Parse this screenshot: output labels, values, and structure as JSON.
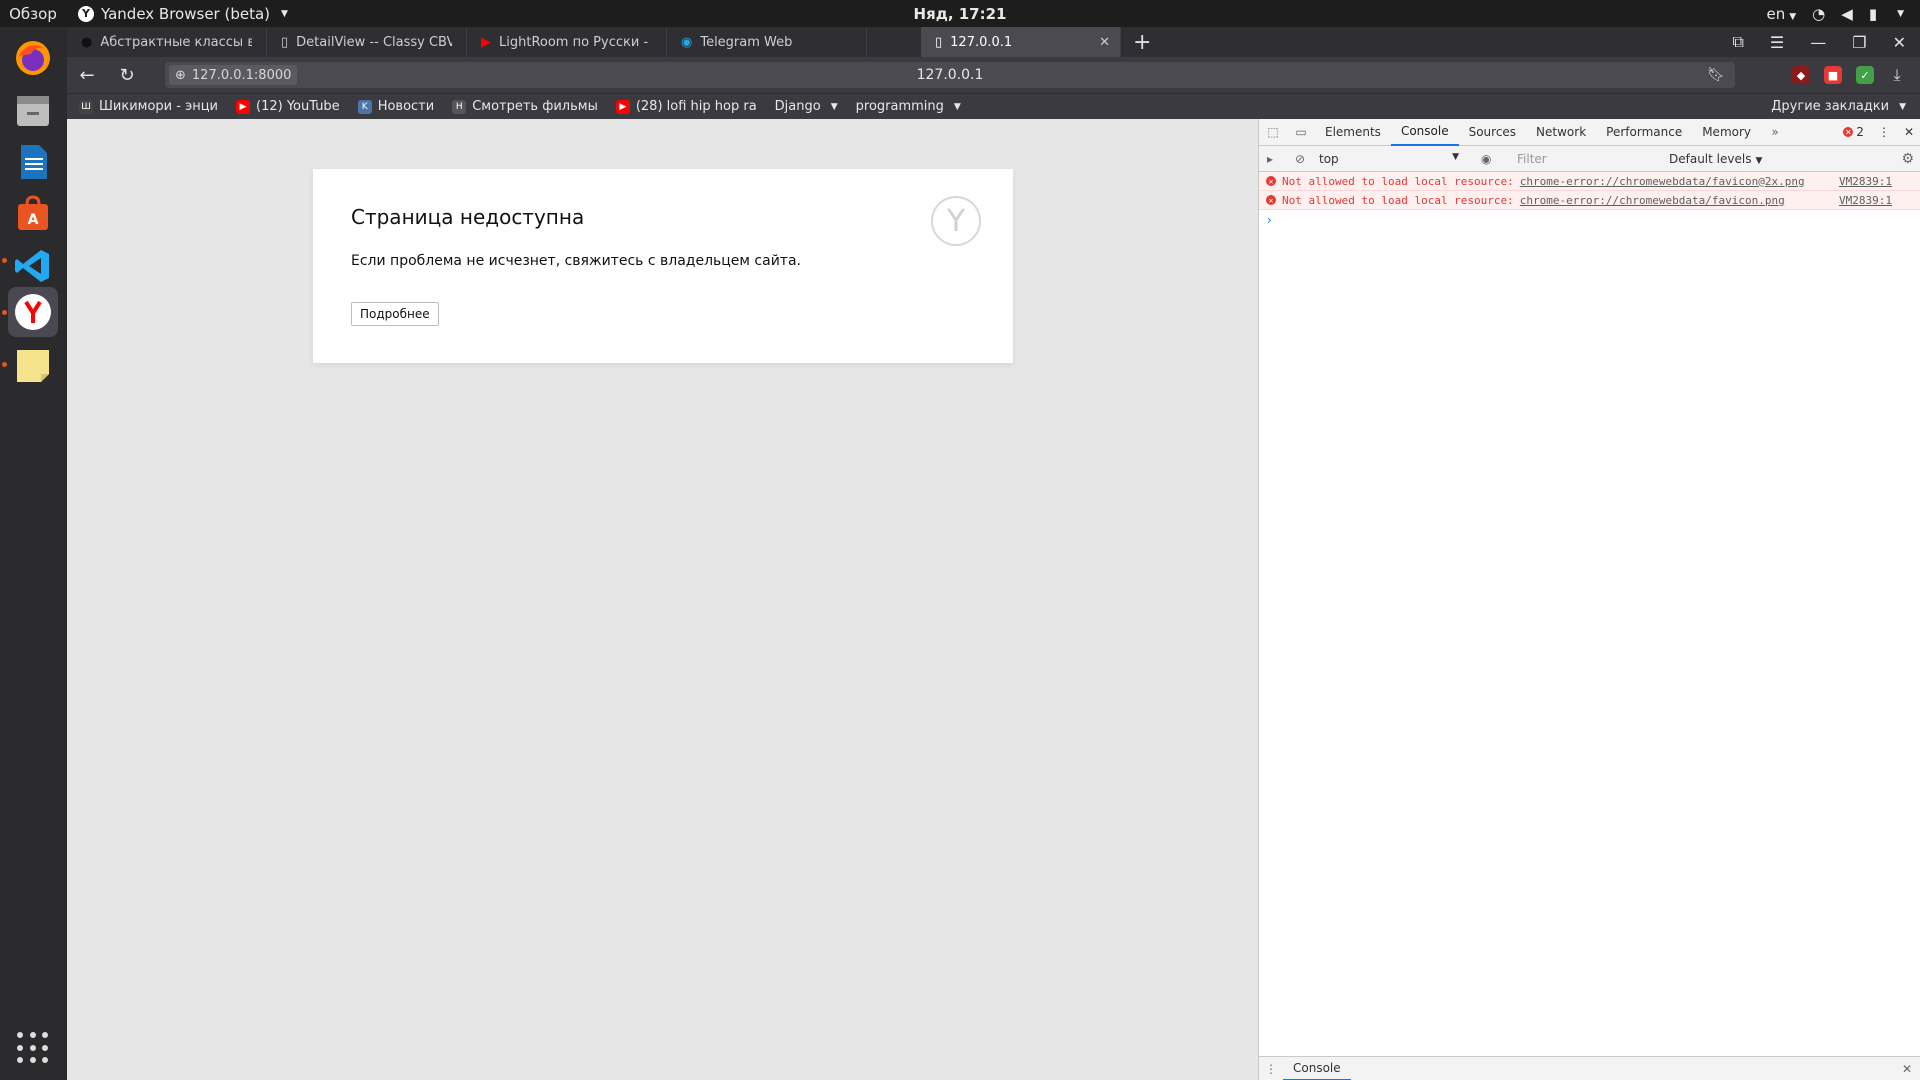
{
  "topbar": {
    "overview": "Обзор",
    "app_name": "Yandex Browser (beta)",
    "clock": "Няд, 17:21",
    "lang": "en"
  },
  "dock": {
    "apps": [
      {
        "name": "firefox",
        "color": "#e66000",
        "running": false
      },
      {
        "name": "files",
        "color": "#9b9b9b",
        "running": false
      },
      {
        "name": "libreoffice-writer",
        "color": "#1e73be",
        "running": false
      },
      {
        "name": "ubuntu-software",
        "color": "#e95420",
        "running": false
      },
      {
        "name": "vscode",
        "color": "#23a9f2",
        "running": true
      },
      {
        "name": "yandex-browser",
        "color": "#ff0000",
        "running": true
      },
      {
        "name": "sticky-notes",
        "color": "#f4e38a",
        "running": true
      }
    ]
  },
  "tabs": [
    {
      "label": "Абстрактные классы в Ру",
      "icon": "github-icon",
      "active": false
    },
    {
      "label": "DetailView -- Classy CBV",
      "icon": "page-icon",
      "active": false
    },
    {
      "label": "LightRoom по Русски - Ha",
      "icon": "youtube-icon",
      "active": false
    },
    {
      "label": "Telegram Web",
      "icon": "telegram-icon",
      "active": false
    },
    {
      "label": "127.0.0.1",
      "icon": "page-icon",
      "active": true
    }
  ],
  "address": {
    "url_badge": "127.0.0.1:8000",
    "page_title": "127.0.0.1"
  },
  "bookmarks": [
    {
      "label": "Шикимори - энци",
      "color": "#444"
    },
    {
      "label": "(12) YouTube",
      "color": "#ff0000"
    },
    {
      "label": "Новости",
      "color": "#4a76a8"
    },
    {
      "label": "Смотреть фильмы",
      "color": "#555"
    },
    {
      "label": "(28) lofi hip hop ra",
      "color": "#ff0000"
    }
  ],
  "bookmark_folders": [
    "Django",
    "programming"
  ],
  "other_bookmarks": "Другие закладки",
  "error_page": {
    "title": "Страница недоступна",
    "message": "Если проблема не исчезнет, свяжитесь с владельцем сайта.",
    "details_button": "Подробнее"
  },
  "devtools": {
    "tabs": [
      "Elements",
      "Console",
      "Sources",
      "Network",
      "Performance",
      "Memory"
    ],
    "active_tab": "Console",
    "error_count": "2",
    "context": "top",
    "filter_placeholder": "Filter",
    "levels": "Default levels",
    "messages": [
      {
        "text": "Not allowed to load local resource:",
        "link": "chrome-error://chromewebdata/favicon@2x.png",
        "source": "VM2839:1"
      },
      {
        "text": "Not allowed to load local resource:",
        "link": "chrome-error://chromewebdata/favicon.png",
        "source": "VM2839:1"
      }
    ],
    "drawer_tab": "Console"
  }
}
